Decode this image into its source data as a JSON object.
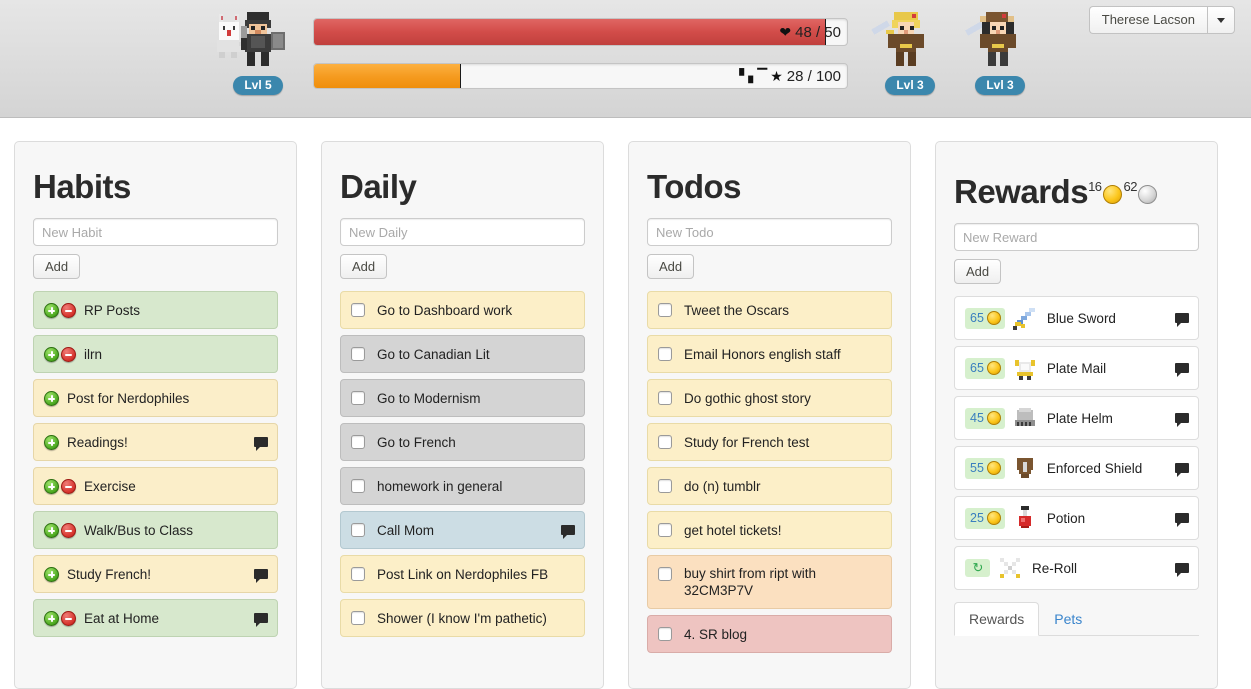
{
  "header": {
    "hp_bar": {
      "current": 48,
      "max": 50,
      "label": "48 / 50",
      "heart_icon": "heart-icon",
      "percent": 96
    },
    "xp_bar": {
      "current": 28,
      "max": 100,
      "label": "28 / 100",
      "star_icon": "star-icon",
      "bars_icon": "signal-bars-icon",
      "percent": 27
    },
    "main_avatar": {
      "level_label": "Lvl 5"
    },
    "party_members": [
      {
        "level_label": "Lvl 3"
      },
      {
        "level_label": "Lvl 3"
      }
    ],
    "user_menu": {
      "name": "Therese Lacson",
      "caret_icon": "chevron-down-icon"
    }
  },
  "columns": [
    {
      "id": "habits",
      "title": "Habits",
      "input_placeholder": "New Habit",
      "add_label": "Add",
      "tasks": [
        {
          "text": "RP Posts",
          "color": "c-green",
          "plus": true,
          "minus": true,
          "comment": false
        },
        {
          "text": "ilrn",
          "color": "c-green",
          "plus": true,
          "minus": true,
          "comment": false
        },
        {
          "text": "Post for Nerdophiles",
          "color": "c-yellow",
          "plus": true,
          "minus": false,
          "comment": false
        },
        {
          "text": "Readings!",
          "color": "c-yellow",
          "plus": true,
          "minus": false,
          "comment": true
        },
        {
          "text": "Exercise",
          "color": "c-yellow",
          "plus": true,
          "minus": true,
          "comment": false
        },
        {
          "text": "Walk/Bus to Class",
          "color": "c-green",
          "plus": true,
          "minus": true,
          "comment": false
        },
        {
          "text": "Study French!",
          "color": "c-yellow",
          "plus": true,
          "minus": false,
          "comment": true
        },
        {
          "text": "Eat at Home",
          "color": "c-green",
          "plus": true,
          "minus": true,
          "comment": true
        }
      ]
    },
    {
      "id": "daily",
      "title": "Daily",
      "input_placeholder": "New Daily",
      "add_label": "Add",
      "tasks": [
        {
          "text": "Go to Dashboard work",
          "color": "c-cream",
          "checkbox": true,
          "comment": false
        },
        {
          "text": "Go to Canadian Lit",
          "color": "c-gray",
          "checkbox": true,
          "comment": false
        },
        {
          "text": "Go to Modernism",
          "color": "c-gray",
          "checkbox": true,
          "comment": false
        },
        {
          "text": "Go to French",
          "color": "c-gray",
          "checkbox": true,
          "comment": false
        },
        {
          "text": "homework in general",
          "color": "c-gray",
          "checkbox": true,
          "comment": false
        },
        {
          "text": "Call Mom",
          "color": "c-blue",
          "checkbox": true,
          "comment": true
        },
        {
          "text": "Post Link on Nerdophiles FB",
          "color": "c-cream",
          "checkbox": true,
          "comment": false
        },
        {
          "text": "Shower (I know I'm pathetic)",
          "color": "c-cream",
          "checkbox": true,
          "comment": false
        }
      ]
    },
    {
      "id": "todos",
      "title": "Todos",
      "input_placeholder": "New Todo",
      "add_label": "Add",
      "tasks": [
        {
          "text": "Tweet the Oscars",
          "color": "c-cream",
          "checkbox": true,
          "comment": false
        },
        {
          "text": "Email Honors english staff",
          "color": "c-cream",
          "checkbox": true,
          "comment": false
        },
        {
          "text": "Do gothic ghost story",
          "color": "c-cream",
          "checkbox": true,
          "comment": false
        },
        {
          "text": "Study for French test",
          "color": "c-cream",
          "checkbox": true,
          "comment": false
        },
        {
          "text": "do (n) tumblr",
          "color": "c-cream",
          "checkbox": true,
          "comment": false
        },
        {
          "text": "get hotel tickets!",
          "color": "c-cream",
          "checkbox": true,
          "comment": false
        },
        {
          "text": "buy shirt from ript with 32CM3P7V",
          "color": "c-orange",
          "checkbox": true,
          "comment": false,
          "two_line": true
        },
        {
          "text": "4. SR blog",
          "color": "c-red",
          "checkbox": true,
          "comment": false
        }
      ]
    },
    {
      "id": "rewards",
      "title": "Rewards",
      "gold": "16",
      "silver": "62",
      "input_placeholder": "New Reward",
      "add_label": "Add",
      "rewards": [
        {
          "cost": "65",
          "currency": "gold",
          "text": "Blue Sword",
          "icon": "blue-sword-icon",
          "comment": true
        },
        {
          "cost": "65",
          "currency": "gold",
          "text": "Plate Mail",
          "icon": "plate-mail-icon",
          "comment": true
        },
        {
          "cost": "45",
          "currency": "gold",
          "text": "Plate Helm",
          "icon": "plate-helm-icon",
          "comment": true
        },
        {
          "cost": "55",
          "currency": "gold",
          "text": "Enforced Shield",
          "icon": "shield-icon",
          "comment": true
        },
        {
          "cost": "25",
          "currency": "gold",
          "text": "Potion",
          "icon": "potion-icon",
          "comment": true
        },
        {
          "cost": "",
          "currency": "reroll",
          "text": "Re-Roll",
          "icon": "crossed-swords-icon",
          "comment": true
        }
      ],
      "tabs": [
        {
          "label": "Rewards",
          "active": true
        },
        {
          "label": "Pets",
          "active": false
        }
      ]
    }
  ],
  "colors": {
    "hp_red": "#d24c49",
    "xp_orange": "#f59a1e",
    "level_badge_blue": "#3b87ad",
    "link_blue": "#3a85cc",
    "panel_bg": "#f7f7f7"
  }
}
